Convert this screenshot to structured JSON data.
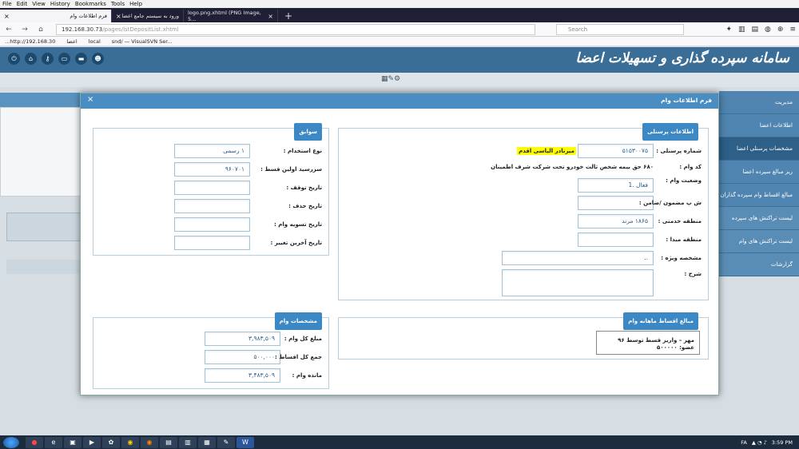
{
  "menubar": [
    "File",
    "Edit",
    "View",
    "History",
    "Bookmarks",
    "Tools",
    "Help"
  ],
  "tabs": [
    {
      "label": "فرم اطلاعات وام",
      "active": true
    },
    {
      "label": "ورود به سیستم جامع اعضا",
      "active": false
    },
    {
      "label": "logo.png.xhtml (PNG Image, 5...",
      "active": false
    }
  ],
  "address": {
    "host": "192.168.30.73",
    "path": "/pages/lstDepositList.xhtml",
    "search_placeholder": "Search"
  },
  "bookmarks": [
    "...http://192.168.30",
    "اعضا",
    "local",
    "snd/ — VisualSVN Ser..."
  ],
  "app": {
    "title": "سامانه سپرده گذاری و تسهیلات اعضا"
  },
  "sidebar": [
    {
      "label": "مدیریت",
      "selected": false
    },
    {
      "label": "اطلاعات اعضا",
      "selected": false
    },
    {
      "label": "مشخصات پرسنلی اعضا",
      "selected": true
    },
    {
      "label": "ریز مبالغ سپرده اعضا",
      "selected": false
    },
    {
      "label": "مبالغ اقساط وام سپرده گذاران",
      "selected": false
    },
    {
      "label": "لیست تراکنش های سپرده",
      "selected": false
    },
    {
      "label": "لیست تراکنش های وام",
      "selected": false
    },
    {
      "label": "گزارشات",
      "selected": false
    }
  ],
  "modal": {
    "title": "فرم اطلاعات وام",
    "close": "×",
    "personal": {
      "title": "اطلاعات پرسنلی",
      "personnel_no_label": "شماره پرسنلی :",
      "personnel_no": "۵۱۵۳۰۰۷۵",
      "name": "میرنادر الیاسی اقدم",
      "loan_code_label": "کد وام :",
      "loan_code": "۶۸۰ حق بیمه شخص ثالث خودرو تحت شرکت شرف اطمینان",
      "loan_status_label": "وضعیت وام :",
      "loan_status": "فعال .1",
      "guarantor_label": "ش پ مضمون /ضامن :",
      "guarantor": "",
      "service_area_label": "منطقه خدمتی :",
      "service_area": "۱۸۶۵ مرند",
      "origin_area_label": "منطقه مبدا :",
      "origin_area": "",
      "special_label": "مشخصه ویژه :",
      "special": "..",
      "desc_label": "شرح :",
      "desc": ""
    },
    "history": {
      "title": "سوابق",
      "employment_type_label": "نوع استخدام :",
      "employment_type": "۱ رسمی",
      "first_installment_label": "سررسید اولین قسط :",
      "first_installment": "۹۶۰۷۰۱",
      "stop_date_label": "تاریخ توقف :",
      "stop_date": "",
      "delete_date_label": "تاریخ حذف :",
      "delete_date": "",
      "settle_date_label": "تاریخ تسویه وام :",
      "settle_date": "",
      "last_change_label": "تاریخ آخرین تغییر :",
      "last_change": ""
    },
    "monthly": {
      "title": "مبالغ اقساط ماهانه وام",
      "line": "۹۶ مهر – واریز قسط توسط عضو: ۵۰۰۰۰۰"
    },
    "loan": {
      "title": "مشخصات وام",
      "total_label": "مبلغ کل وام :",
      "total": "۳,۹۸۳,۵۰۹",
      "installments_label": "جمع کل اقساط :",
      "installments": "۵۰۰,۰۰۰",
      "remain_label": "مانده وام :",
      "remain": "۳,۴۸۳,۵۰۹"
    }
  },
  "taskbar": {
    "lang": "FA",
    "time": "3:59 PM"
  },
  "colors": {
    "header": "#3a6e96",
    "sidebar": "#4f85b0",
    "accent": "#3c88c5",
    "highlight": "#ffff00"
  }
}
